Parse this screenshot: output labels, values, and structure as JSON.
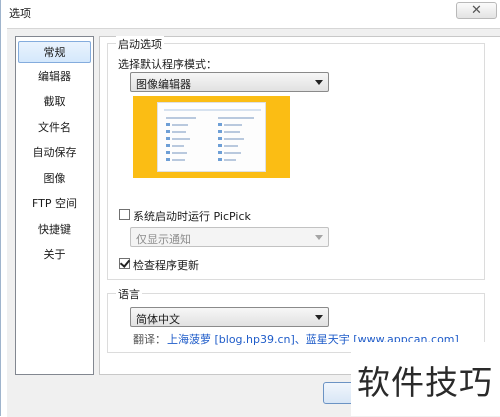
{
  "window": {
    "title": "选项",
    "close_glyph": "✕"
  },
  "nav": {
    "items": [
      {
        "label": "常规",
        "selected": true
      },
      {
        "label": "编辑器"
      },
      {
        "label": "截取"
      },
      {
        "label": "文件名"
      },
      {
        "label": "自动保存"
      },
      {
        "label": "图像"
      },
      {
        "label": "FTP 空间"
      },
      {
        "label": "快捷键"
      },
      {
        "label": "关于"
      }
    ]
  },
  "startup": {
    "group_label": "启动选项",
    "mode_label": "选择默认程序模式：",
    "mode_value": "图像编辑器",
    "run_on_startup_label": "系统启动时运行 PicPick",
    "run_on_startup_checked": false,
    "notify_value": "仅显示通知",
    "check_updates_label": "检查程序更新",
    "check_updates_checked": true
  },
  "language": {
    "group_label": "语言",
    "value": "简体中文",
    "translation_prefix": "翻译：",
    "translation_credit": "上海菠萝 [blog.hp39.cn]、蓝星天宇 [www.appcan.com]"
  },
  "watermark": {
    "text": "软件技巧"
  },
  "colors": {
    "preview_bg": "#fbbd14",
    "link": "#1f5cc9"
  }
}
